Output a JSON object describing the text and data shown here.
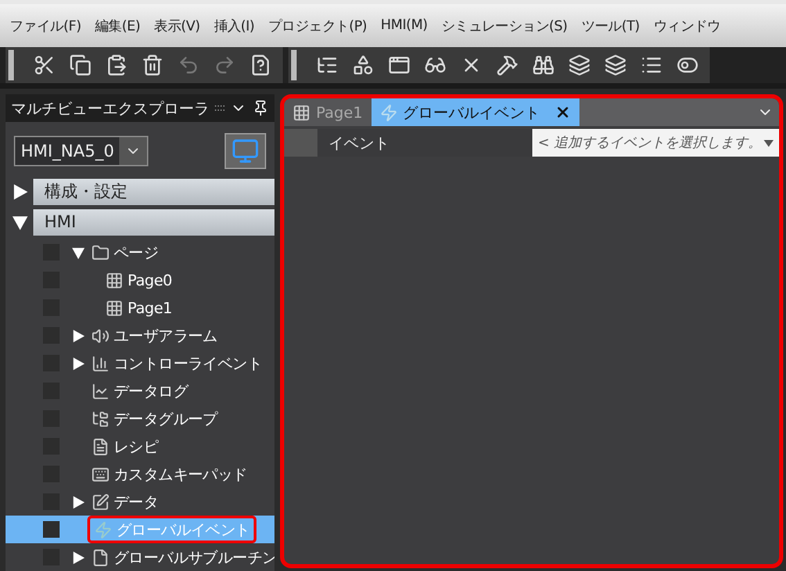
{
  "menu": [
    "ファイル(F)",
    "編集(E)",
    "表示(V)",
    "挿入(I)",
    "プロジェクト(P)",
    "HMI(M)",
    "シミュレーション(S)",
    "ツール(T)",
    "ウィンドウ"
  ],
  "toolbar": {
    "groups": [
      {
        "icons": [
          {
            "disabled": false
          },
          {
            "disabled": false
          },
          {
            "disabled": false
          },
          {
            "disabled": false
          },
          {
            "disabled": true
          },
          {
            "disabled": true
          },
          {
            "disabled": false
          }
        ]
      },
      {
        "icons": [
          {
            "disabled": false
          },
          {
            "disabled": false
          },
          {
            "disabled": false
          },
          {
            "disabled": false
          },
          {
            "disabled": false
          },
          {
            "disabled": false
          },
          {
            "disabled": false
          },
          {
            "disabled": false
          },
          {
            "disabled": false
          },
          {
            "disabled": false
          },
          {
            "disabled": false
          }
        ]
      }
    ]
  },
  "explorer": {
    "title": "マルチビューエクスプローラ",
    "device": "HMI_NA5_0",
    "sections": [
      {
        "label": "構成・設定",
        "expanded": false
      },
      {
        "label": "HMI",
        "expanded": true,
        "children": [
          {
            "label": "ページ",
            "expanded": true,
            "selected": false,
            "highlighted": false,
            "children": [
              {
                "label": "Page0",
                "selected": false,
                "highlighted": false
              },
              {
                "label": "Page1",
                "selected": false,
                "highlighted": false
              }
            ]
          },
          {
            "label": "ユーザアラーム",
            "expanded": false,
            "selected": false,
            "highlighted": false
          },
          {
            "label": "コントローライベント",
            "expanded": false,
            "selected": false,
            "highlighted": false
          },
          {
            "label": "データログ",
            "selected": false,
            "highlighted": false
          },
          {
            "label": "データグループ",
            "selected": false,
            "highlighted": false
          },
          {
            "label": "レシピ",
            "selected": false,
            "highlighted": false
          },
          {
            "label": "カスタムキーパッド",
            "selected": false,
            "highlighted": false
          },
          {
            "label": "データ",
            "expanded": false,
            "selected": false,
            "highlighted": false
          },
          {
            "label": "グローバルイベント",
            "selected": true,
            "highlighted": true
          },
          {
            "label": "グローバルサブルーチン",
            "expanded": false,
            "selected": false,
            "highlighted": false
          }
        ]
      }
    ]
  },
  "editor": {
    "highlighted": true,
    "tabs": [
      {
        "label": "Page1",
        "selected": false,
        "closable": false
      },
      {
        "label": "グローバルイベント",
        "selected": true,
        "closable": true
      }
    ],
    "column": "イベント",
    "event_select": {
      "placeholder": "< 追加するイベントを選択します。"
    }
  }
}
